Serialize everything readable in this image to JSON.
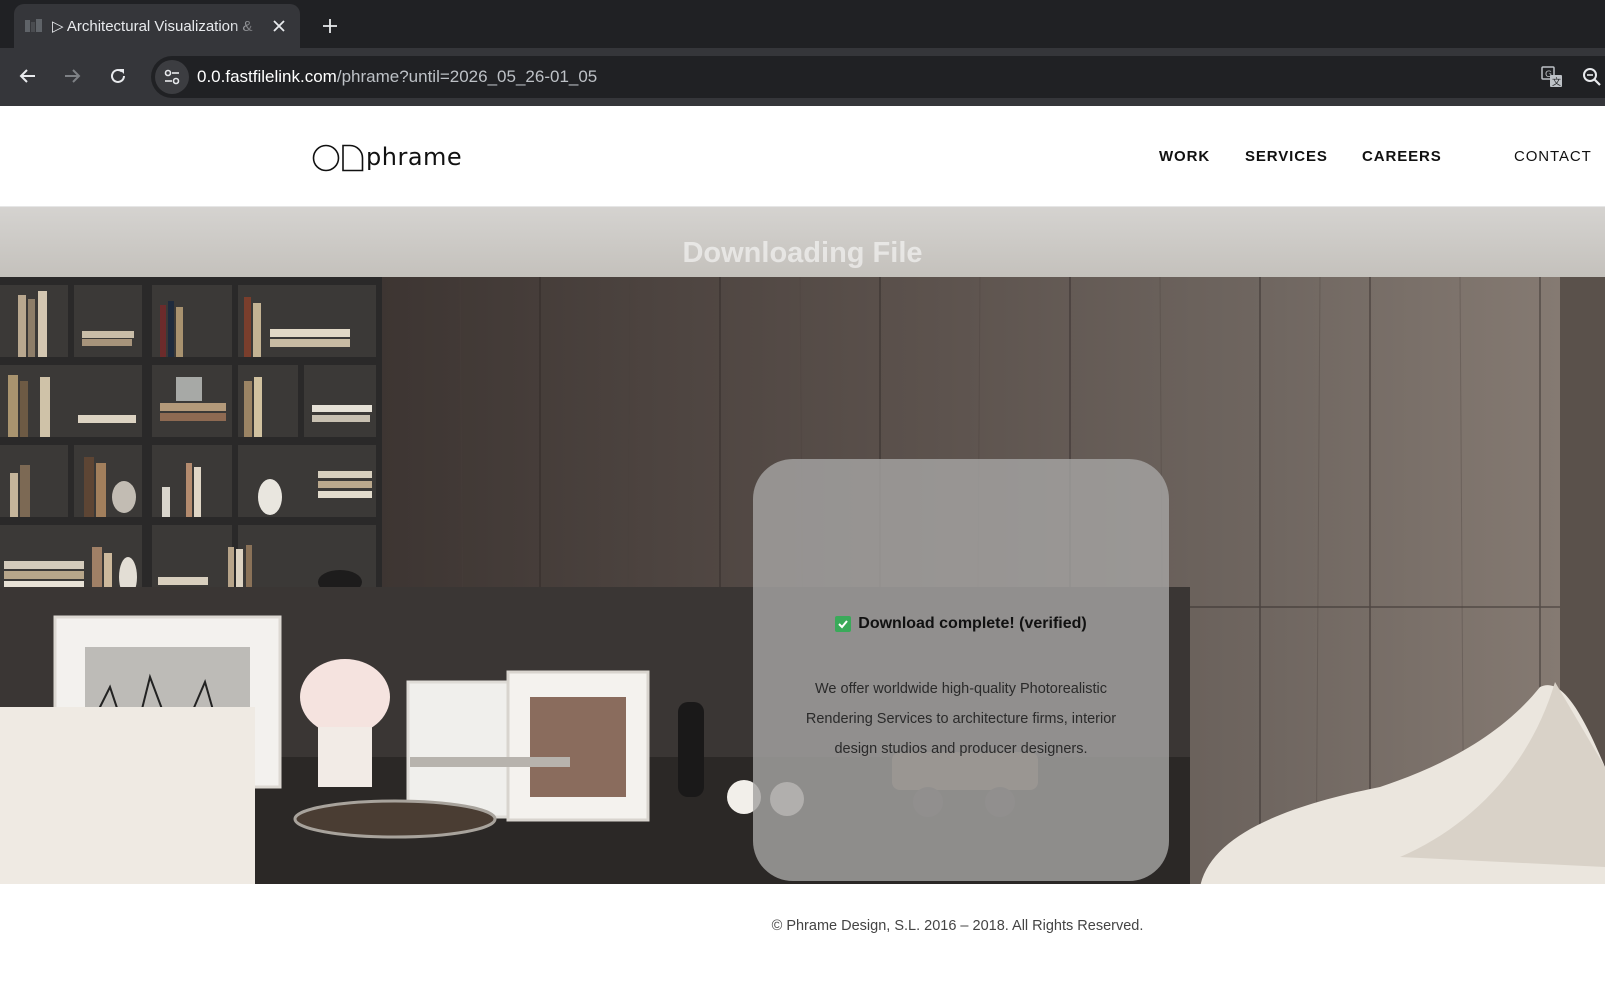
{
  "browser": {
    "tab": {
      "title": "▷ Architectural Visualization & "
    },
    "address_bar": {
      "host": "0.0.fastfilelink.com",
      "path": "/phrame?until=2026_05_26-01_05"
    },
    "icons": [
      "back-icon",
      "forward-icon",
      "reload-icon",
      "site-info-icon",
      "translate-icon",
      "zoom-icon",
      "close-icon",
      "plus-icon"
    ]
  },
  "site": {
    "logo_text": "OD phrame",
    "nav": {
      "work": "WORK",
      "services": "SERVICES",
      "careers": "CAREERS",
      "contact": "CONTACT"
    }
  },
  "hero": {
    "overlay_title": "Downloading File",
    "card": {
      "status": "Download complete! (verified)",
      "body": "We offer worldwide high-quality Photorealistic Rendering Services to architecture firms, interior design studios and producer designers."
    }
  },
  "footer": {
    "copyright": "© Phrame Design, S.L. 2016 – 2018. All Rights Reserved."
  },
  "colors": {
    "chrome_dark": "#202124",
    "chrome_tab": "#35363a",
    "check_green": "#3aaa5a"
  }
}
